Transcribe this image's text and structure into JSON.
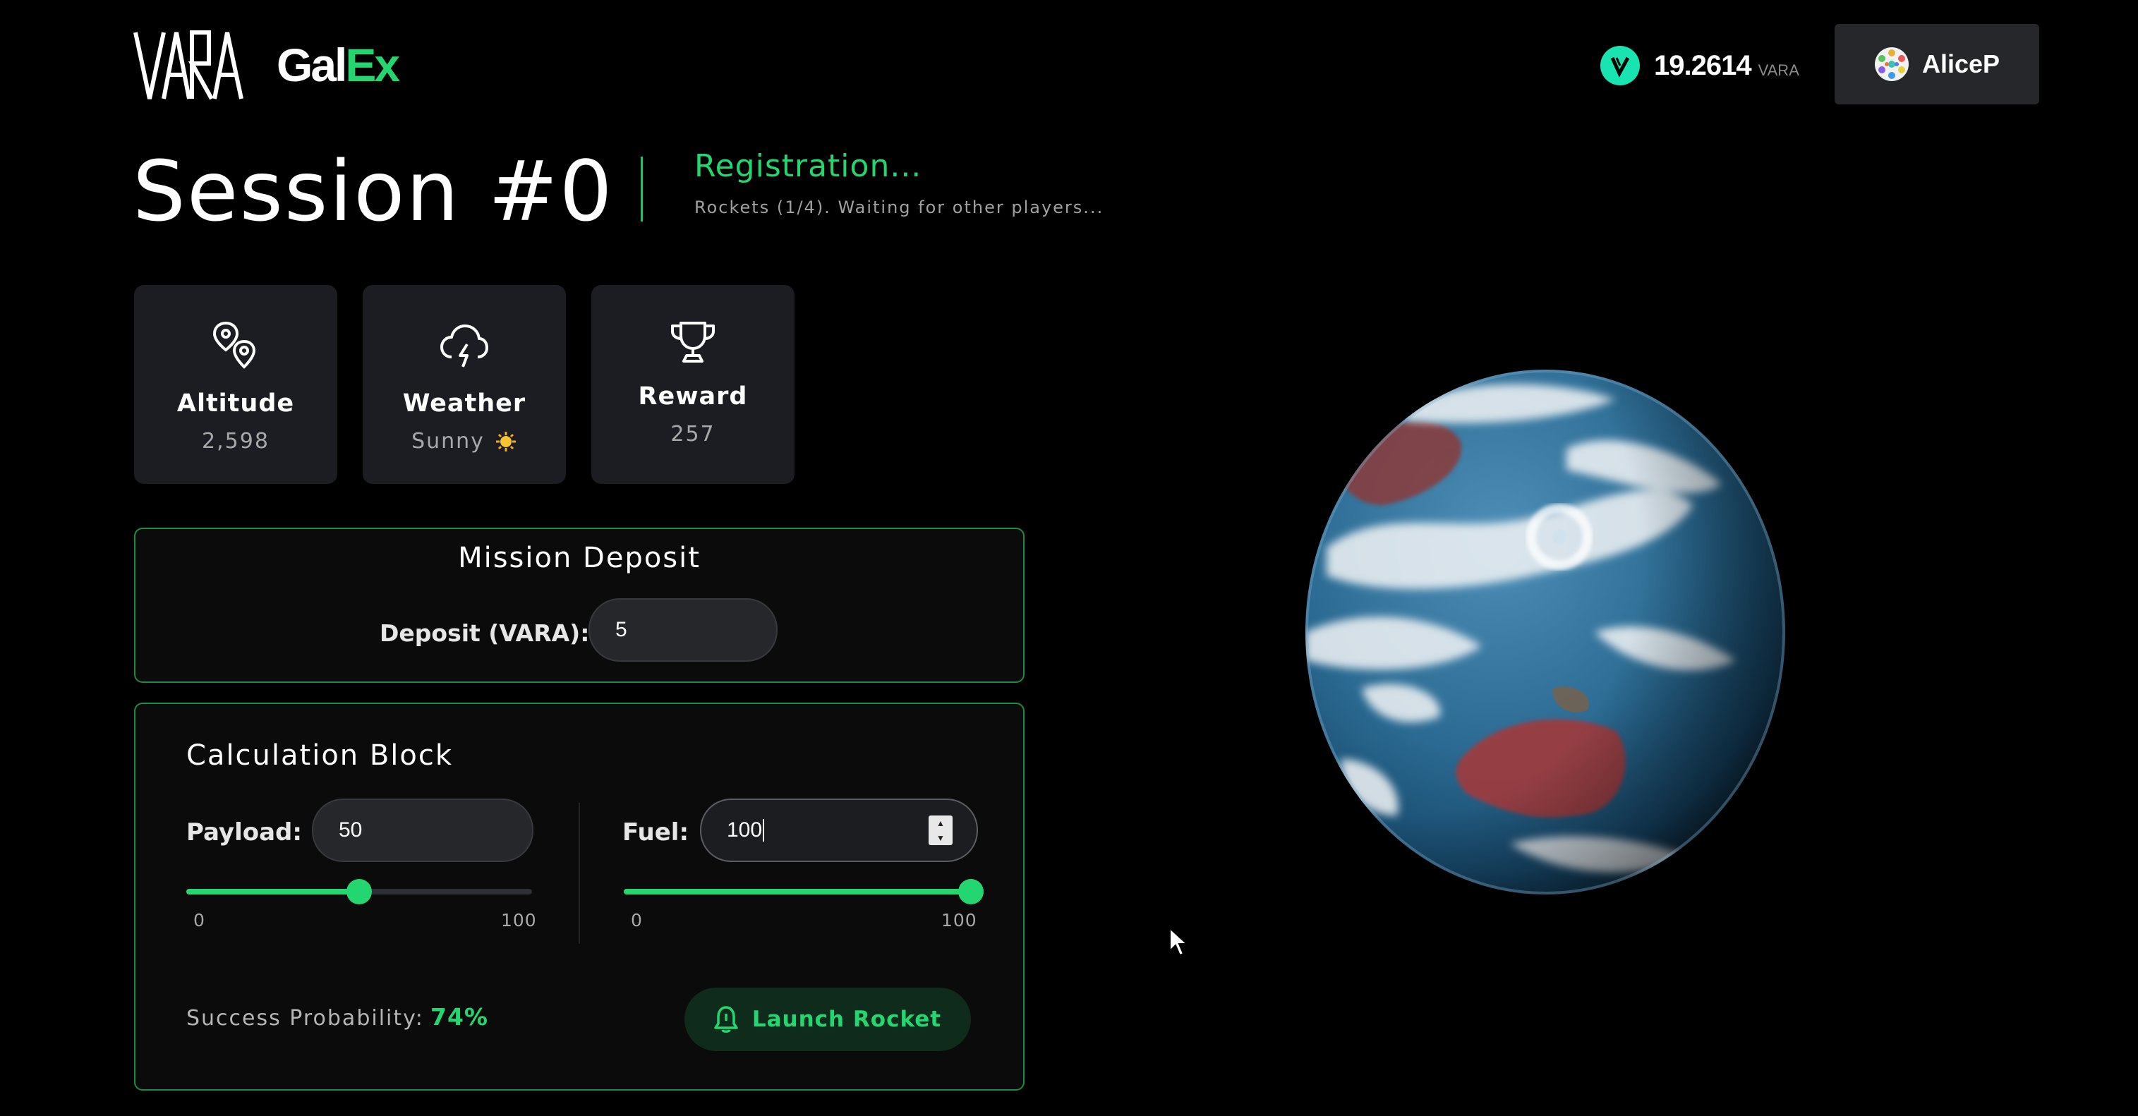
{
  "header": {
    "vara_logo_text": "VARA",
    "galex_logo": {
      "part1": "Gal",
      "part2": "Ex"
    },
    "balance": {
      "value": "19.2614",
      "unit": "VARA",
      "icon": "vara-coin-icon"
    },
    "account": {
      "name": "AliceP",
      "icon": "polkadot-identicon"
    }
  },
  "session": {
    "title": "Session #0",
    "status": "Registration...",
    "subtitle": "Rockets (1/4). Waiting for other players..."
  },
  "cards": [
    {
      "label": "Altitude",
      "value": "2,598",
      "icon": "map-pins-icon"
    },
    {
      "label": "Weather",
      "value": "Sunny",
      "icon": "cloud-lightning-icon",
      "badge_icon": "sun-icon"
    },
    {
      "label": "Reward",
      "value": "257",
      "icon": "trophy-icon"
    }
  ],
  "deposit": {
    "title": "Mission Deposit",
    "label": "Deposit (VARA):",
    "value": "5"
  },
  "calculation": {
    "title": "Calculation Block",
    "payload": {
      "label": "Payload:",
      "value": "50",
      "slider_value": 50,
      "min": "0",
      "max": "100"
    },
    "fuel": {
      "label": "Fuel:",
      "value": "100",
      "slider_value": 100,
      "min": "0",
      "max": "100"
    },
    "success_label": "Success Probability:",
    "success_value": "74%",
    "launch_label": "Launch Rocket"
  },
  "colors": {
    "accent": "#24d66f",
    "card": "#1c1d22",
    "panel_border": "#1f8a44",
    "coin": "#19e3b1"
  }
}
